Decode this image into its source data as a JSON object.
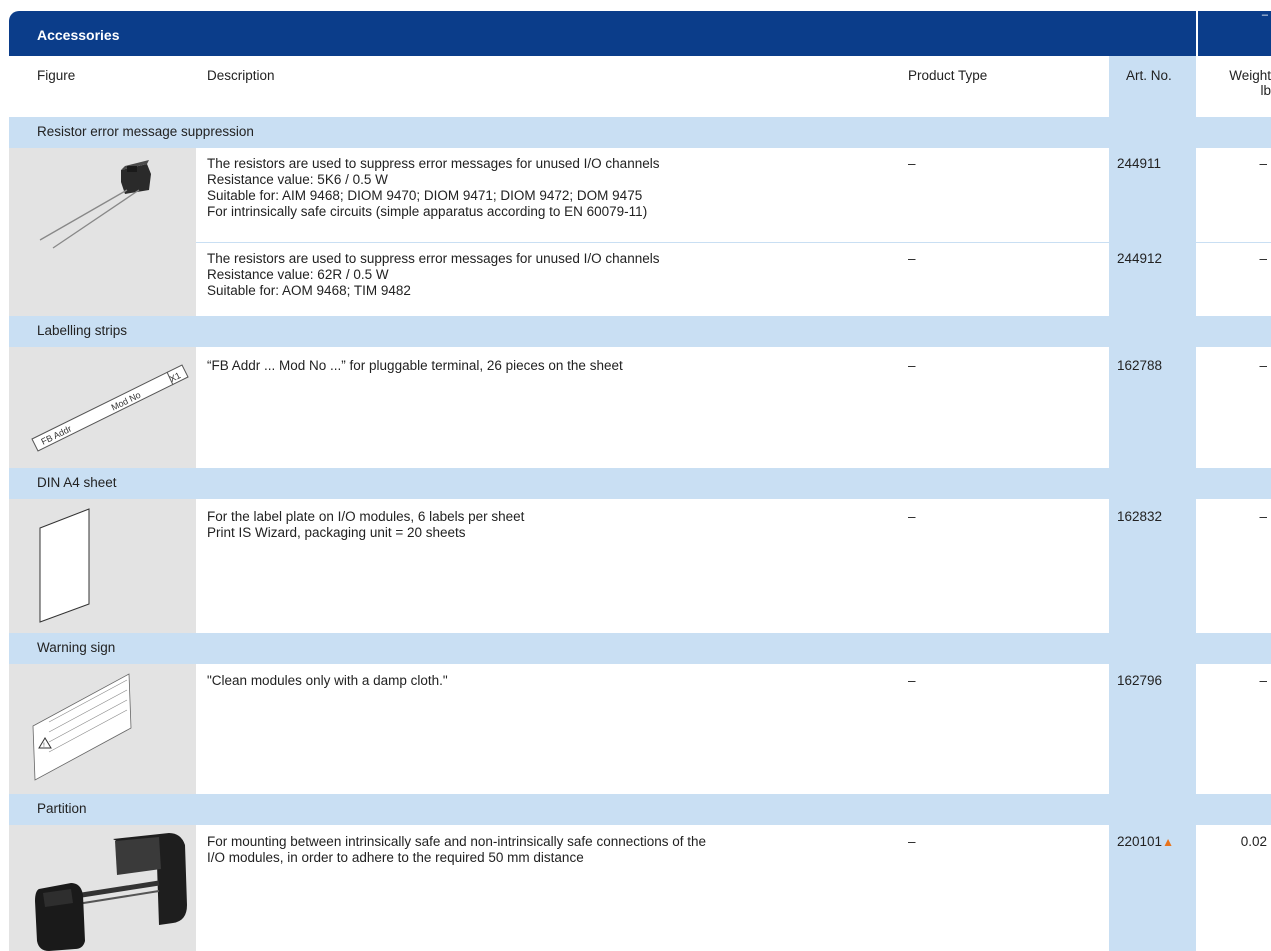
{
  "title": "Accessories",
  "title_right": "–",
  "columns": {
    "figure": "Figure",
    "description": "Description",
    "product_type": "Product Type",
    "art_no": "Art. No.",
    "weight_line1": "Weight",
    "weight_line2": "lb"
  },
  "colors": {
    "title_bar": "#0b3d8a",
    "category_band": "#c9dff3",
    "figure_bg": "#e3e3e3",
    "new_marker": "#e8731b"
  },
  "groups": [
    {
      "name": "Resistor error message suppression",
      "figure": "resistor-icon",
      "rows": [
        {
          "description": [
            "The resistors are used to suppress error messages for unused I/O channels",
            "Resistance value: 5K6 / 0.5 W",
            "Suitable for: AIM 9468; DIOM 9470; DIOM 9471; DIOM 9472; DOM 9475",
            "For intrinsically safe circuits (simple apparatus according to EN 60079-11)"
          ],
          "product_type": "–",
          "art_no": "244911",
          "weight": "–"
        },
        {
          "description": [
            "The resistors are used to suppress error messages for unused I/O channels",
            "Resistance value: 62R / 0.5 W",
            "Suitable for: AOM 9468; TIM 9482"
          ],
          "product_type": "–",
          "art_no": "244912",
          "weight": "–"
        }
      ]
    },
    {
      "name": "Labelling strips",
      "figure": "label-strip-icon",
      "figure_labels": [
        "FB Addr",
        "Mod No",
        "X1"
      ],
      "rows": [
        {
          "description": [
            "“FB Addr ... Mod No ...” for pluggable terminal, 26 pieces on the sheet"
          ],
          "product_type": "–",
          "art_no": "162788",
          "weight": "–"
        }
      ]
    },
    {
      "name": "DIN A4 sheet",
      "figure": "sheet-icon",
      "rows": [
        {
          "description": [
            "For the label plate on I/O modules, 6 labels per sheet",
            "Print IS Wizard, packaging unit = 20 sheets"
          ],
          "product_type": "–",
          "art_no": "162832",
          "weight": "–"
        }
      ]
    },
    {
      "name": "Warning sign",
      "figure": "warning-sign-icon",
      "rows": [
        {
          "description": [
            "\"Clean modules only with a damp cloth.\""
          ],
          "product_type": "–",
          "art_no": "162796",
          "weight": "–"
        }
      ]
    },
    {
      "name": "Partition",
      "figure": "partition-icon",
      "rows": [
        {
          "description": [
            "For mounting between intrinsically safe and non-intrinsically safe connections of the",
            "I/O modules, in order to adhere to the required 50 mm distance"
          ],
          "product_type": "–",
          "art_no": "220101",
          "art_marker": "▲",
          "weight": "0.02"
        }
      ]
    }
  ]
}
